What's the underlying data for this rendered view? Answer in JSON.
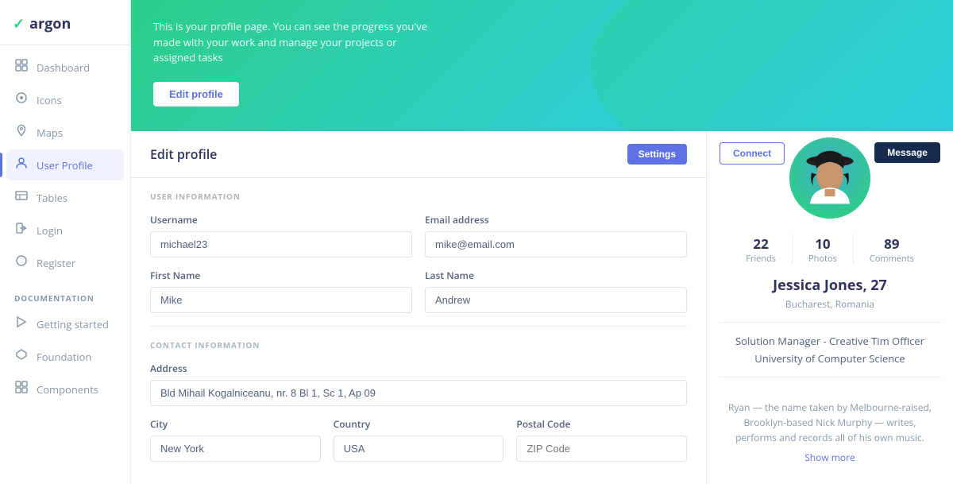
{
  "sidebar": {
    "logo": "argon",
    "nav_items": [
      {
        "id": "dashboard",
        "label": "Dashboard",
        "icon": "▭"
      },
      {
        "id": "icons",
        "label": "Icons",
        "icon": "◎"
      },
      {
        "id": "maps",
        "label": "Maps",
        "icon": "◉"
      },
      {
        "id": "user-profile",
        "label": "User Profile",
        "icon": "◈",
        "active": true
      },
      {
        "id": "tables",
        "label": "Tables",
        "icon": "≡"
      },
      {
        "id": "login",
        "label": "Login",
        "icon": "→"
      },
      {
        "id": "register",
        "label": "Register",
        "icon": "◌"
      }
    ],
    "doc_section": "DOCUMENTATION",
    "doc_items": [
      {
        "id": "getting-started",
        "label": "Getting started",
        "icon": "⚡"
      },
      {
        "id": "foundation",
        "label": "Foundation",
        "icon": "⬡"
      },
      {
        "id": "components",
        "label": "Components",
        "icon": "⊞"
      }
    ]
  },
  "hero": {
    "description": "This is your profile page. You can see the progress you've made with your work and manage your projects or assigned tasks",
    "edit_button": "Edit profile"
  },
  "form": {
    "title": "Edit profile",
    "settings_button": "Settings",
    "user_info_section": "USER INFORMATION",
    "fields": {
      "username_label": "Username",
      "username_value": "michael23",
      "email_label": "Email address",
      "email_value": "mike@email.com",
      "first_name_label": "First Name",
      "first_name_value": "Mike",
      "last_name_label": "Last Name",
      "last_name_value": "Andrew"
    },
    "contact_section": "CONTACT INFORMATION",
    "contact_fields": {
      "address_label": "Address",
      "address_value": "Bld Mihail Kogalniceanu, nr. 8 Bl 1, Sc 1, Ap 09",
      "city_label": "City",
      "city_value": "New York",
      "country_label": "Country",
      "country_value": "USA",
      "postal_label": "Postal Code",
      "postal_placeholder": "ZIP Code"
    }
  },
  "profile": {
    "connect_button": "Connect",
    "message_button": "Message",
    "stats": [
      {
        "value": "22",
        "label": "Friends"
      },
      {
        "value": "10",
        "label": "Photos"
      },
      {
        "value": "89",
        "label": "Comments"
      }
    ],
    "name": "Jessica Jones",
    "age": "27",
    "location": "Bucharest, Romania",
    "role": "Solution Manager - Creative Tim Officer",
    "university": "University of Computer Science",
    "bio": "Ryan — the name taken by Melbourne-raised, Brooklyn-based Nick Murphy — writes, performs and records all of his own music.",
    "show_more": "Show more"
  }
}
